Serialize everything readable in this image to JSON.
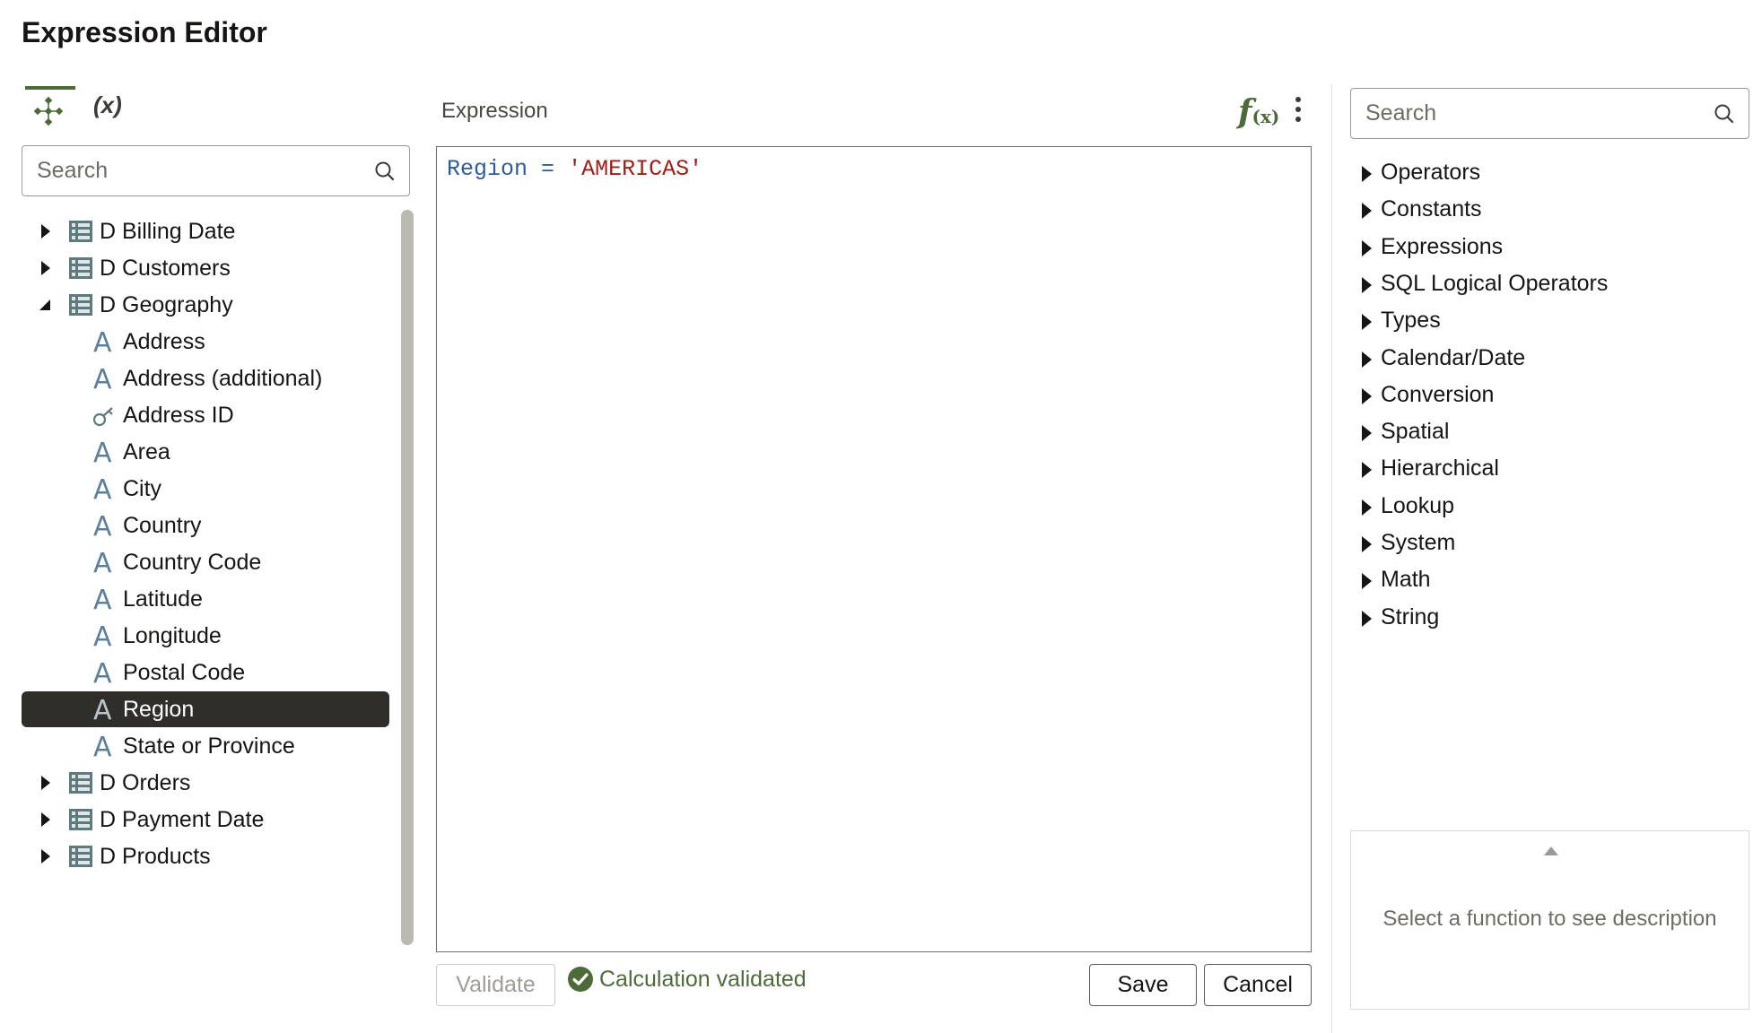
{
  "title": "Expression Editor",
  "left": {
    "tabs": [
      {
        "name": "data-elements",
        "icon": "data-elements-icon",
        "label": ""
      },
      {
        "name": "variables",
        "label": "(x)"
      }
    ],
    "search_placeholder": "Search",
    "tree": [
      {
        "label": "D Billing Date",
        "type": "table",
        "expanded": false
      },
      {
        "label": "D Customers",
        "type": "table",
        "expanded": false
      },
      {
        "label": "D Geography",
        "type": "table",
        "expanded": true
      },
      {
        "label": "Address",
        "type": "attribute"
      },
      {
        "label": "Address (additional)",
        "type": "attribute"
      },
      {
        "label": "Address ID",
        "type": "key"
      },
      {
        "label": "Area",
        "type": "attribute"
      },
      {
        "label": "City",
        "type": "attribute"
      },
      {
        "label": "Country",
        "type": "attribute"
      },
      {
        "label": "Country Code",
        "type": "attribute"
      },
      {
        "label": "Latitude",
        "type": "attribute"
      },
      {
        "label": "Longitude",
        "type": "attribute"
      },
      {
        "label": "Postal Code",
        "type": "attribute"
      },
      {
        "label": "Region",
        "type": "attribute",
        "selected": true
      },
      {
        "label": "State or Province",
        "type": "attribute"
      },
      {
        "label": "D Orders",
        "type": "table",
        "expanded": false
      },
      {
        "label": "D Payment Date",
        "type": "table",
        "expanded": false
      },
      {
        "label": "D Products",
        "type": "table",
        "expanded": false
      }
    ]
  },
  "editor": {
    "label": "Expression",
    "fx_f": "f",
    "fx_x": "(x)",
    "code": {
      "identifier": "Region",
      "operator": "=",
      "string": "'AMERICAS'"
    },
    "validate_label": "Validate",
    "status": "Calculation validated",
    "save_label": "Save",
    "cancel_label": "Cancel"
  },
  "right": {
    "search_placeholder": "Search",
    "functions": [
      "Operators",
      "Constants",
      "Expressions",
      "SQL Logical Operators",
      "Types",
      "Calendar/Date",
      "Conversion",
      "Spatial",
      "Hierarchical",
      "Lookup",
      "System",
      "Math",
      "String"
    ],
    "description": "Select a function to see description"
  },
  "colors": {
    "accent": "#4d6b38",
    "selected_bg": "#2f2e2b",
    "attr_icon": "#5d7f9e",
    "string": "#9d1d17",
    "identifier": "#2f5c9b"
  }
}
